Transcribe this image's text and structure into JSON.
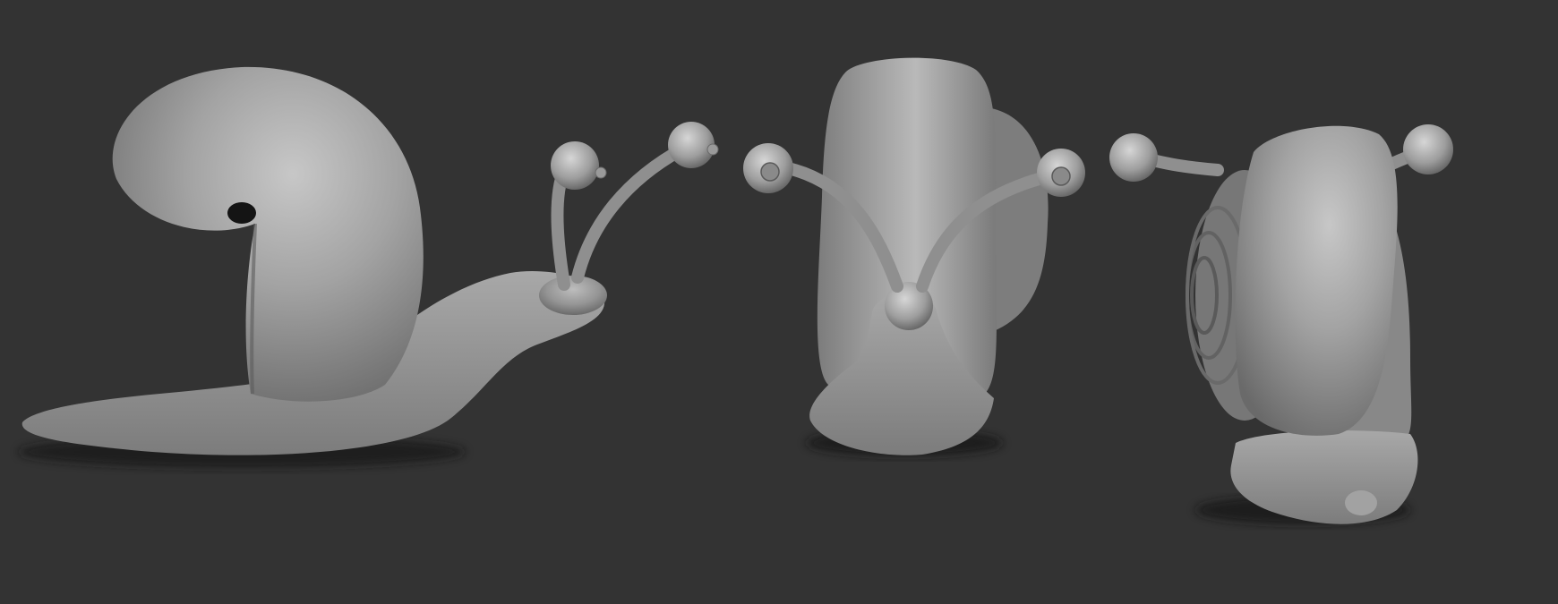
{
  "viewport": {
    "background": "#333333",
    "model_color": "#8e8e8e",
    "highlight_color": "#c4c4c4",
    "shadow_color": "#151515"
  },
  "views": [
    {
      "name": "side-view"
    },
    {
      "name": "front-view"
    },
    {
      "name": "three-quarter-view"
    }
  ]
}
